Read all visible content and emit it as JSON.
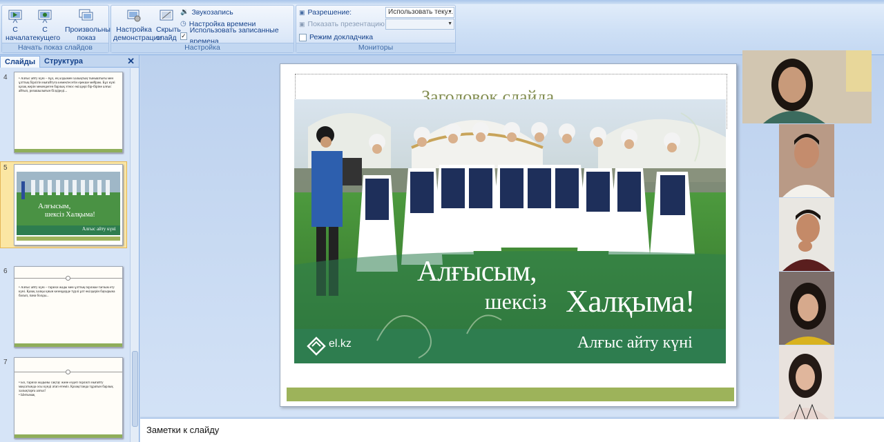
{
  "ribbon": {
    "start_group": {
      "label": "Начать показ слайдов",
      "from_beginning": "С начала",
      "from_current": "С текущего слайда",
      "custom_show": "Произвольный показ"
    },
    "setup_group": {
      "label": "Настройка",
      "setup_show": "Настройка демонстрации",
      "hide_slide": "Скрыть слайд",
      "record_narration": "Звукозапись",
      "rehearse_timings": "Настройка времени",
      "use_timings": "Использовать записанные времена",
      "use_timings_checked": true
    },
    "monitors_group": {
      "label": "Мониторы",
      "resolution_label": "Разрешение:",
      "resolution_value": "Использовать теку...",
      "show_on_label": "Показать презентацию на:",
      "presenter_view": "Режим докладчика",
      "presenter_view_checked": false
    }
  },
  "left_pane": {
    "tab_slides": "Слайды",
    "tab_outline": "Структура",
    "close": "✕",
    "slides": [
      {
        "num": "4",
        "text": "• Алғыс айту күні – бұл, ең алдымен халықтың тыныштығы мен ұлттық бірлігін нығайтуға көмектесетін ерекше мейрам. Бұл күні қазақ жерін мекендеген барлық этнос өкілдері бір-біріне алғыс айтып, ризашылығын білдіреді..."
      },
      {
        "num": "5",
        "text1": "Алғысым,",
        "text2": "шексіз Халқыма!",
        "text3": "Алғыс айту күні"
      },
      {
        "num": "6",
        "text": "• Алғыс айту күні – тарихи жады мен ұлттық бірлікке тағзым ету күні. Қазақ халқы қиын кезеңдерде түрлі ұлт өкілдерін бауырына басып, пана болды..."
      },
      {
        "num": "7",
        "text": "• Біз, тарихи жадыны сақтау және елдегі бірлікті нығайту мақсатында осы күнді атап өтеміз. Қазақстанда тұратын барлық халықтарға алғыс!\n• Ынтымақ"
      }
    ]
  },
  "slide": {
    "ghost_title": "Заголовок слайда",
    "line1": "Алғысым,",
    "line2a": "шексіз",
    "line2b": "Халқыма!",
    "subtitle": "Алғыс айту күні",
    "logo": "el.kz"
  },
  "notes": {
    "placeholder": "Заметки к слайду"
  },
  "colors": {
    "accent": "#15428b",
    "green": "#2e7d4f",
    "olive": "#9db35a"
  }
}
